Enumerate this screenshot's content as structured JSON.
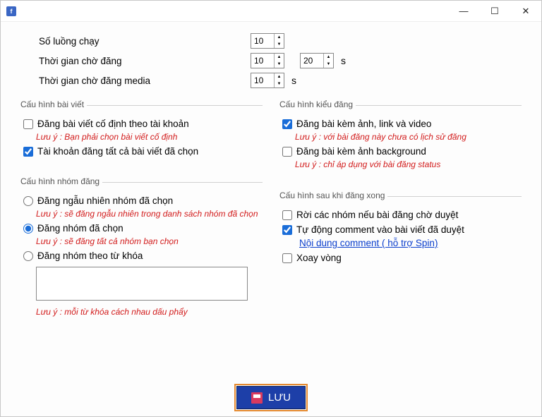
{
  "top": {
    "threads_label": "Số luồng chạy",
    "threads_value": "10",
    "wait_post_label": "Thời gian chờ đăng",
    "wait_post_min": "10",
    "wait_post_max": "20",
    "wait_post_unit": "s",
    "wait_media_label": "Thời gian chờ đăng media",
    "wait_media_value": "10",
    "wait_media_unit": "s"
  },
  "grp_post": {
    "title": "Cấu hình bài viết",
    "fixed_per_account": "Đăng bài viết cố định theo tài khoản",
    "fixed_per_account_checked": false,
    "fixed_note": "Lưu ý : Bạn phải chọn bài viết cố định",
    "account_all_selected": "Tài khoản đăng tất cả bài viết đã chọn",
    "account_all_selected_checked": true
  },
  "grp_group": {
    "title": "Cấu hình nhóm đăng",
    "random_selected": "Đăng ngẫu nhiên nhóm đã chọn",
    "random_note": "Lưu ý : sẽ đăng ngẫu nhiên trong danh sách nhóm đã chọn",
    "selected_groups": "Đăng nhóm đã chọn",
    "selected_note": "Lưu ý : sẽ đăng tất cả nhóm bạn chọn",
    "by_keyword": "Đăng nhóm theo từ khóa",
    "keyword_note": "Lưu ý : mỗi từ khóa cách nhau dấu phẩy",
    "radio_value": "selected"
  },
  "grp_type": {
    "title": "Cấu hình kiểu đăng",
    "with_media": "Đăng bài kèm ảnh, link và video",
    "with_media_checked": true,
    "with_media_note": "Lưu ý : với bài đăng này chưa có lịch sử đăng",
    "with_bg": "Đăng bài kèm ảnh background",
    "with_bg_checked": false,
    "with_bg_note": "Lưu ý : chỉ áp dụng với bài đăng status"
  },
  "grp_after": {
    "title": "Cấu hình sau khi đăng xong",
    "leave_pending": "Rời các nhóm nếu bài đăng chờ duyệt",
    "leave_pending_checked": false,
    "auto_comment": "Tự động comment vào bài viết đã duyệt",
    "auto_comment_checked": true,
    "comment_link": "Nội dung comment ( hỗ trợ Spin)",
    "loop": "Xoay vòng",
    "loop_checked": false
  },
  "save_label": "LƯU"
}
